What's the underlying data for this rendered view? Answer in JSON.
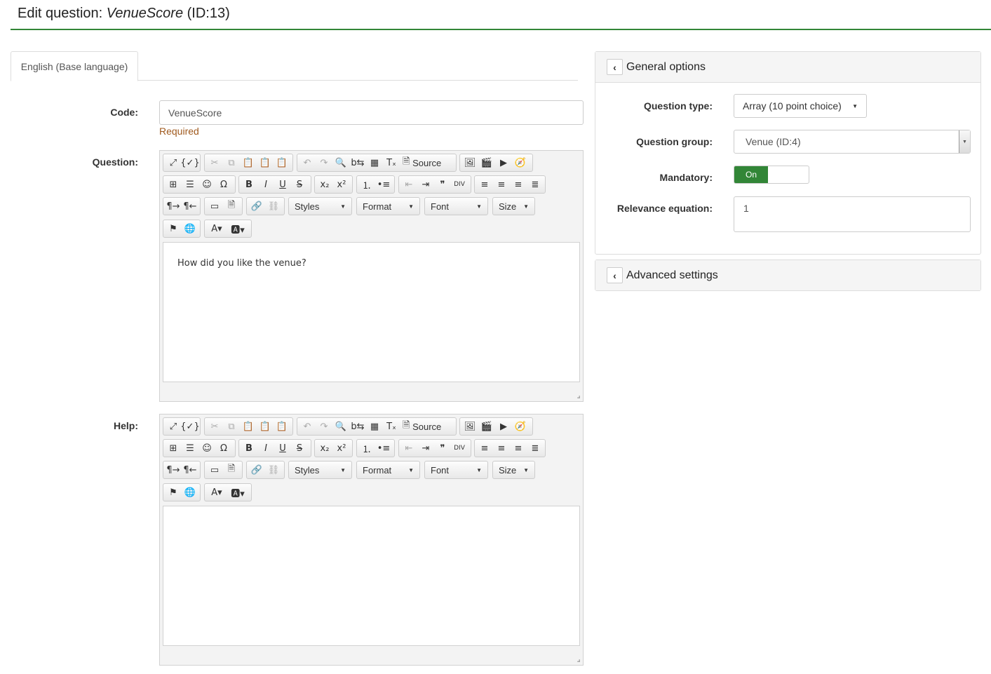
{
  "header": {
    "title_prefix": "Edit question: ",
    "question_code": "VenueScore",
    "title_suffix": " (ID:13)"
  },
  "tabs": [
    {
      "label": "English (Base language)"
    }
  ],
  "form": {
    "code_label": "Code:",
    "code_value": "VenueScore",
    "required_text": "Required",
    "question_label": "Question:",
    "question_text": "How did you like the venue?",
    "help_label": "Help:",
    "help_text": ""
  },
  "editor": {
    "source_label": "Source",
    "styles_label": "Styles",
    "format_label": "Format",
    "font_label": "Font",
    "size_label": "Size"
  },
  "general_options": {
    "title": "General options",
    "question_type_label": "Question type:",
    "question_type_value": "Array (10 point choice)",
    "question_group_label": "Question group:",
    "question_group_value": "Venue (ID:4)",
    "mandatory_label": "Mandatory:",
    "mandatory_value": "On",
    "relevance_label": "Relevance equation:",
    "relevance_value": "1"
  },
  "advanced_settings": {
    "title": "Advanced settings"
  },
  "colors": {
    "accent": "#328637",
    "required": "#a05a1e"
  }
}
